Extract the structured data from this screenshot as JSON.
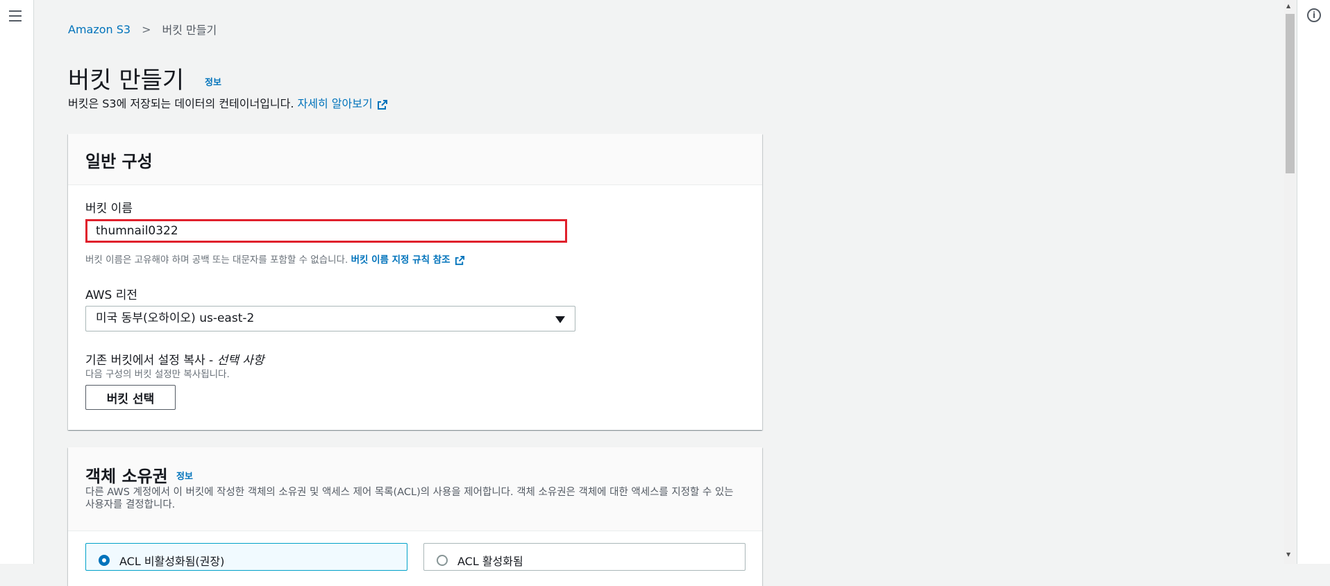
{
  "breadcrumb": {
    "root": "Amazon S3",
    "separator": ">",
    "current": "버킷 만들기"
  },
  "header": {
    "title": "버킷 만들기",
    "info_link": "정보",
    "subtitle": "버킷은 S3에 저장되는 데이터의 컨테이너입니다.",
    "learn_more": "자세히 알아보기"
  },
  "general": {
    "heading": "일반 구성",
    "bucket_name_label": "버킷 이름",
    "bucket_name_value": "thumnail0322",
    "bucket_name_hint": "버킷 이름은 고유해야 하며 공백 또는 대문자를 포함할 수 없습니다.",
    "bucket_name_rules_link": "버킷 이름 지정 규칙 참조",
    "region_label": "AWS 리전",
    "region_value": "미국 동부(오하이오) us-east-2",
    "copy_label": "기존 버킷에서 설정 복사 -",
    "copy_optional": "선택 사항",
    "copy_hint": "다음 구성의 버킷 설정만 복사됩니다.",
    "choose_bucket_button": "버킷 선택"
  },
  "ownership": {
    "heading": "객체 소유권",
    "info_link": "정보",
    "description": "다른 AWS 계정에서 이 버킷에 작성한 객체의 소유권 및 액세스 제어 목록(ACL)의 사용을 제어합니다. 객체 소유권은 객체에 대한 액세스를 지정할 수 있는 사용자를 결정합니다.",
    "option_disabled": "ACL 비활성화됨(권장)",
    "option_enabled": "ACL 활성화됨",
    "selected": "ACL 비활성화됨(권장)"
  },
  "icons": {
    "menu": "hamburger-menu-icon",
    "info": "info-circle-icon",
    "external": "external-link-icon",
    "caret": "caret-down-icon"
  },
  "colors": {
    "link": "#0073bb",
    "highlight_border": "#e0202c",
    "selected_tile": "#00a1c9"
  }
}
